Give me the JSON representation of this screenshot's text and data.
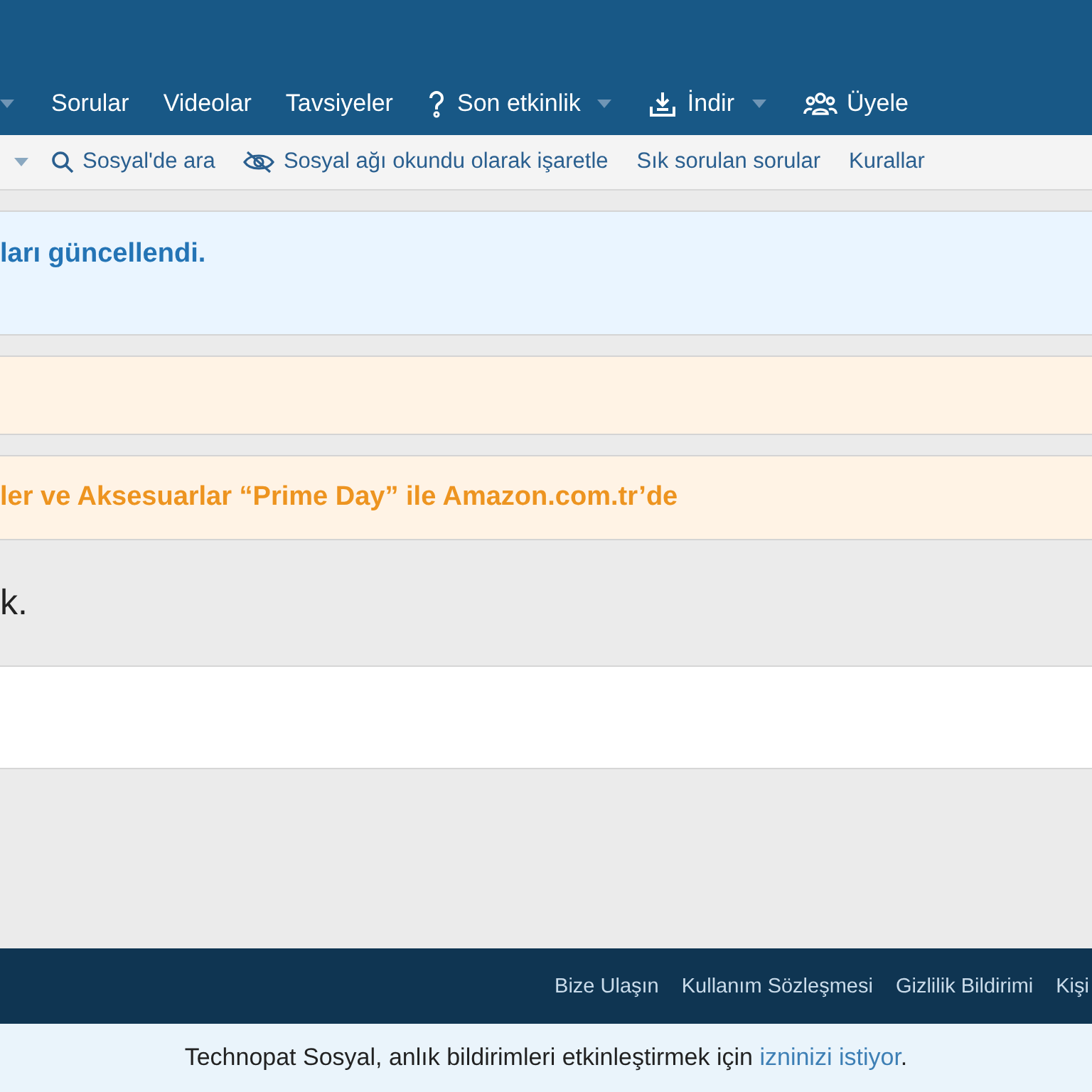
{
  "nav": {
    "items": [
      {
        "label": "Sorular",
        "dropdown": false
      },
      {
        "label": "Videolar",
        "dropdown": false
      },
      {
        "label": "Tavsiyeler",
        "dropdown": false
      },
      {
        "label": "Son etkinlik",
        "dropdown": true
      },
      {
        "label": "İndir",
        "dropdown": true
      },
      {
        "label": "Üyele",
        "dropdown": false
      }
    ]
  },
  "subnav": {
    "items": [
      {
        "label": "Sosyal'de ara"
      },
      {
        "label": "Sosyal ağı okundu olarak işaretle"
      },
      {
        "label": "Sık sorulan sorular"
      },
      {
        "label": "Kurallar"
      }
    ]
  },
  "notices": [
    {
      "kind": "info",
      "text": "ları güncellendi."
    },
    {
      "kind": "warning"
    },
    {
      "kind": "warning",
      "text": "ler ve Aksesuarlar “Prime Day” ile Amazon.com.tr’de"
    }
  ],
  "message": "k.",
  "footer": {
    "links": [
      "Bize Ulaşın",
      "Kullanım Sözleşmesi",
      "Gizlilik Bildirimi",
      "Kişi"
    ]
  },
  "push_notice": {
    "text": "Technopat Sosyal, anlık bildirimleri etkinleştirmek için ",
    "link": "izninizi istiyor",
    "end": "."
  }
}
